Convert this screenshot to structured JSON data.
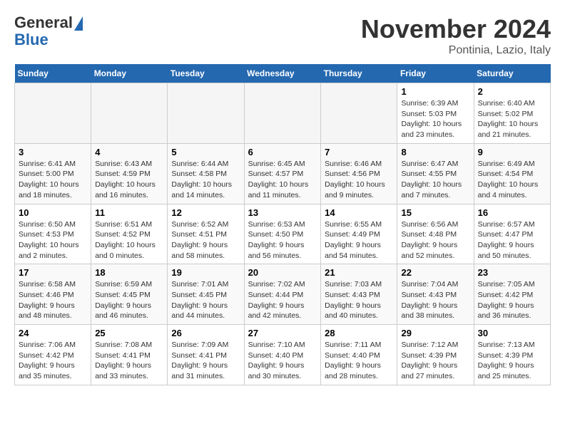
{
  "logo": {
    "line1": "General",
    "line2": "Blue"
  },
  "header": {
    "month": "November 2024",
    "location": "Pontinia, Lazio, Italy"
  },
  "weekdays": [
    "Sunday",
    "Monday",
    "Tuesday",
    "Wednesday",
    "Thursday",
    "Friday",
    "Saturday"
  ],
  "weeks": [
    [
      {
        "day": "",
        "info": ""
      },
      {
        "day": "",
        "info": ""
      },
      {
        "day": "",
        "info": ""
      },
      {
        "day": "",
        "info": ""
      },
      {
        "day": "",
        "info": ""
      },
      {
        "day": "1",
        "info": "Sunrise: 6:39 AM\nSunset: 5:03 PM\nDaylight: 10 hours and 23 minutes."
      },
      {
        "day": "2",
        "info": "Sunrise: 6:40 AM\nSunset: 5:02 PM\nDaylight: 10 hours and 21 minutes."
      }
    ],
    [
      {
        "day": "3",
        "info": "Sunrise: 6:41 AM\nSunset: 5:00 PM\nDaylight: 10 hours and 18 minutes."
      },
      {
        "day": "4",
        "info": "Sunrise: 6:43 AM\nSunset: 4:59 PM\nDaylight: 10 hours and 16 minutes."
      },
      {
        "day": "5",
        "info": "Sunrise: 6:44 AM\nSunset: 4:58 PM\nDaylight: 10 hours and 14 minutes."
      },
      {
        "day": "6",
        "info": "Sunrise: 6:45 AM\nSunset: 4:57 PM\nDaylight: 10 hours and 11 minutes."
      },
      {
        "day": "7",
        "info": "Sunrise: 6:46 AM\nSunset: 4:56 PM\nDaylight: 10 hours and 9 minutes."
      },
      {
        "day": "8",
        "info": "Sunrise: 6:47 AM\nSunset: 4:55 PM\nDaylight: 10 hours and 7 minutes."
      },
      {
        "day": "9",
        "info": "Sunrise: 6:49 AM\nSunset: 4:54 PM\nDaylight: 10 hours and 4 minutes."
      }
    ],
    [
      {
        "day": "10",
        "info": "Sunrise: 6:50 AM\nSunset: 4:53 PM\nDaylight: 10 hours and 2 minutes."
      },
      {
        "day": "11",
        "info": "Sunrise: 6:51 AM\nSunset: 4:52 PM\nDaylight: 10 hours and 0 minutes."
      },
      {
        "day": "12",
        "info": "Sunrise: 6:52 AM\nSunset: 4:51 PM\nDaylight: 9 hours and 58 minutes."
      },
      {
        "day": "13",
        "info": "Sunrise: 6:53 AM\nSunset: 4:50 PM\nDaylight: 9 hours and 56 minutes."
      },
      {
        "day": "14",
        "info": "Sunrise: 6:55 AM\nSunset: 4:49 PM\nDaylight: 9 hours and 54 minutes."
      },
      {
        "day": "15",
        "info": "Sunrise: 6:56 AM\nSunset: 4:48 PM\nDaylight: 9 hours and 52 minutes."
      },
      {
        "day": "16",
        "info": "Sunrise: 6:57 AM\nSunset: 4:47 PM\nDaylight: 9 hours and 50 minutes."
      }
    ],
    [
      {
        "day": "17",
        "info": "Sunrise: 6:58 AM\nSunset: 4:46 PM\nDaylight: 9 hours and 48 minutes."
      },
      {
        "day": "18",
        "info": "Sunrise: 6:59 AM\nSunset: 4:45 PM\nDaylight: 9 hours and 46 minutes."
      },
      {
        "day": "19",
        "info": "Sunrise: 7:01 AM\nSunset: 4:45 PM\nDaylight: 9 hours and 44 minutes."
      },
      {
        "day": "20",
        "info": "Sunrise: 7:02 AM\nSunset: 4:44 PM\nDaylight: 9 hours and 42 minutes."
      },
      {
        "day": "21",
        "info": "Sunrise: 7:03 AM\nSunset: 4:43 PM\nDaylight: 9 hours and 40 minutes."
      },
      {
        "day": "22",
        "info": "Sunrise: 7:04 AM\nSunset: 4:43 PM\nDaylight: 9 hours and 38 minutes."
      },
      {
        "day": "23",
        "info": "Sunrise: 7:05 AM\nSunset: 4:42 PM\nDaylight: 9 hours and 36 minutes."
      }
    ],
    [
      {
        "day": "24",
        "info": "Sunrise: 7:06 AM\nSunset: 4:42 PM\nDaylight: 9 hours and 35 minutes."
      },
      {
        "day": "25",
        "info": "Sunrise: 7:08 AM\nSunset: 4:41 PM\nDaylight: 9 hours and 33 minutes."
      },
      {
        "day": "26",
        "info": "Sunrise: 7:09 AM\nSunset: 4:41 PM\nDaylight: 9 hours and 31 minutes."
      },
      {
        "day": "27",
        "info": "Sunrise: 7:10 AM\nSunset: 4:40 PM\nDaylight: 9 hours and 30 minutes."
      },
      {
        "day": "28",
        "info": "Sunrise: 7:11 AM\nSunset: 4:40 PM\nDaylight: 9 hours and 28 minutes."
      },
      {
        "day": "29",
        "info": "Sunrise: 7:12 AM\nSunset: 4:39 PM\nDaylight: 9 hours and 27 minutes."
      },
      {
        "day": "30",
        "info": "Sunrise: 7:13 AM\nSunset: 4:39 PM\nDaylight: 9 hours and 25 minutes."
      }
    ]
  ]
}
